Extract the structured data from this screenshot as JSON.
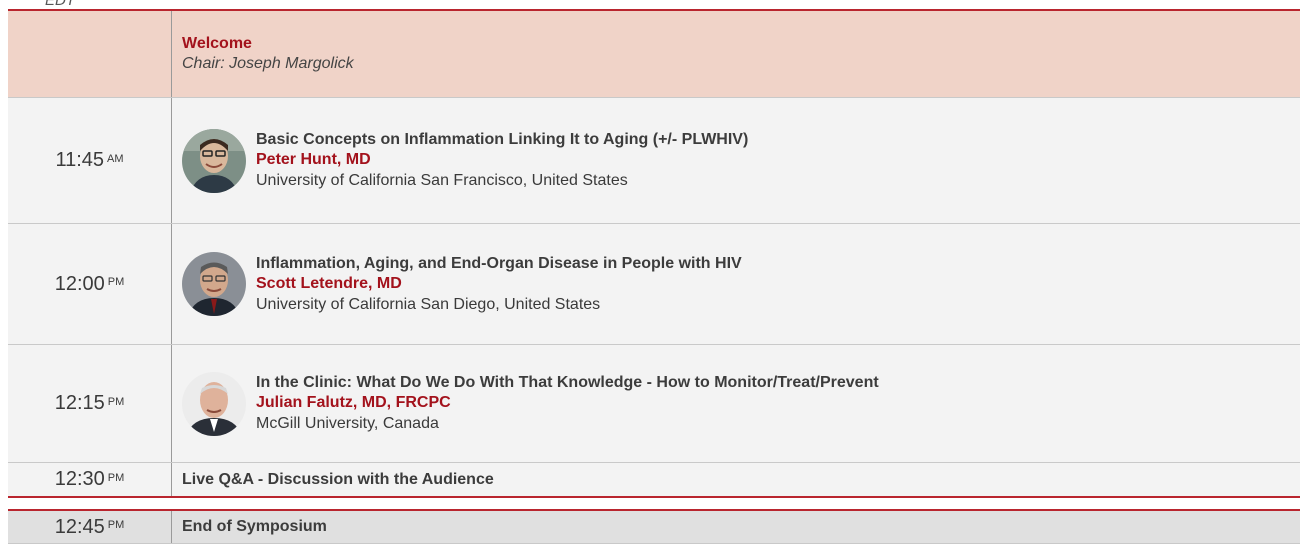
{
  "timezone_label": "EDT",
  "welcome": {
    "title": "Welcome",
    "chair": "Chair:  Joseph Margolick"
  },
  "talks": [
    {
      "time": "11:45",
      "ampm": "AM",
      "title": "Basic Concepts on Inflammation Linking It to Aging (+/- PLWHIV)",
      "speaker": "Peter Hunt, MD",
      "affiliation": "University of California San Francisco, United States",
      "photo": "speaker-photo-peter-hunt"
    },
    {
      "time": "12:00",
      "ampm": "PM",
      "title": "Inflammation, Aging, and End-Organ Disease in People with HIV",
      "speaker": "Scott Letendre, MD",
      "affiliation": "University of California San Diego, United States",
      "photo": "speaker-photo-scott-letendre"
    },
    {
      "time": "12:15",
      "ampm": "PM",
      "title": "In the Clinic: What Do We Do With That Knowledge - How to Monitor/Treat/Prevent",
      "speaker": "Julian Falutz, MD, FRCPC",
      "affiliation": "McGill University, Canada",
      "photo": "speaker-photo-julian-falutz"
    }
  ],
  "qa": {
    "time": "12:30",
    "ampm": "PM",
    "label": "Live Q&A - Discussion with the Audience"
  },
  "end": {
    "time": "12:45",
    "ampm": "PM",
    "label": "End of Symposium"
  },
  "colors": {
    "accent_red": "#a3121c",
    "border_red": "#b9252e",
    "welcome_bg": "#f0d3c8",
    "row_bg": "#f3f3f3",
    "end_bg": "#e0e0e0"
  }
}
